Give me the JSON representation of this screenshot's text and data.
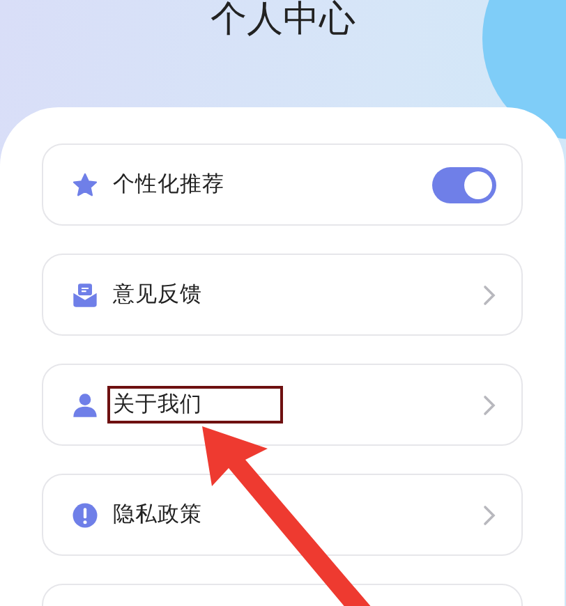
{
  "header": {
    "title": "个人中心"
  },
  "rows": [
    {
      "kind": "toggle",
      "label": "个性化推荐",
      "on": true,
      "highlighted": false
    },
    {
      "kind": "link",
      "label": "意见反馈",
      "highlighted": false
    },
    {
      "kind": "link",
      "label": "关于我们",
      "highlighted": true
    },
    {
      "kind": "link",
      "label": "隐私政策",
      "highlighted": false
    },
    {
      "kind": "blank"
    }
  ]
}
